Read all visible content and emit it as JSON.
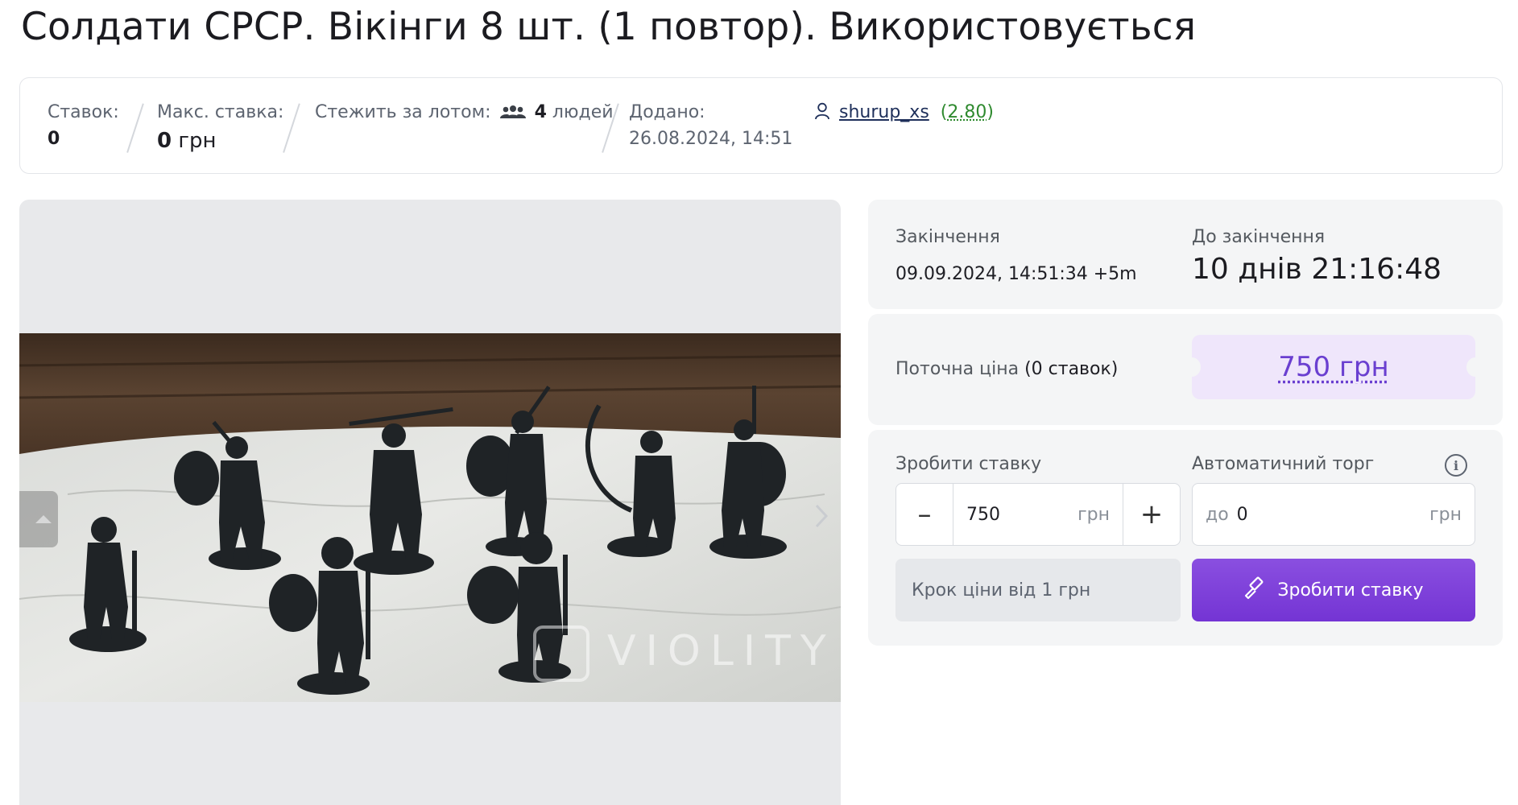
{
  "page": {
    "title": "Солдати СРСР. Вікінги 8 шт. (1 повтор). Використовується"
  },
  "info": {
    "bids_label": "Ставок:",
    "bids_value": "0",
    "max_bid_label": "Макс. ставка:",
    "max_bid_value": "0",
    "max_bid_currency": "грн",
    "watch_label": "Стежить за лотом:",
    "watch_count": "4",
    "watch_suffix": "людей",
    "added_label": "Додано:",
    "added_value": "26.08.2024, 14:51",
    "seller_name": "shurup_xs",
    "seller_rating": "2.80"
  },
  "gallery": {
    "watermark": "VIOLITY",
    "next_icon": "chevron-right-icon",
    "prev_icon": "chevron-left-icon"
  },
  "timing": {
    "end_label": "Закінчення",
    "end_value": "09.09.2024, 14:51:34 +5m",
    "remaining_label": "До закінчення",
    "remaining_value": "10 днів 21:16:48"
  },
  "price": {
    "label_prefix": "Поточна ціна",
    "label_bids": "(0 ставок)",
    "value": "750 грн"
  },
  "bid": {
    "make_bid_label": "Зробити ставку",
    "auto_label": "Автоматичний торг",
    "amount": "750",
    "currency": "грн",
    "minus": "–",
    "plus": "+",
    "auto_prefix": "до",
    "auto_value": "0",
    "step_hint": "Крок ціни від 1 грн",
    "submit_label": "Зробити ставку"
  },
  "colors": {
    "accent": "#7434d4",
    "price_bg": "#efe6fb",
    "price_text": "#6a3fd0",
    "rating": "#2f8a2f"
  }
}
